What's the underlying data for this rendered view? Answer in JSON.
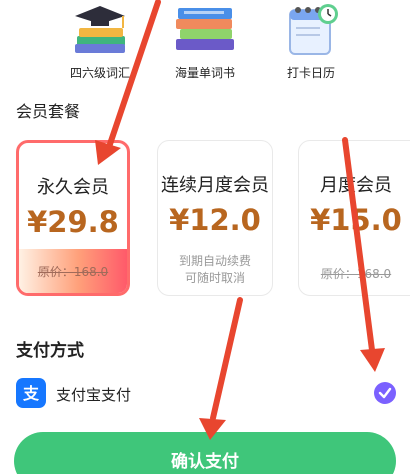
{
  "features": [
    {
      "label": "四六级词汇",
      "icon": "grad-cap-books-icon"
    },
    {
      "label": "海量单词书",
      "icon": "book-stack-icon"
    },
    {
      "label": "打卡日历",
      "icon": "calendar-clock-icon"
    }
  ],
  "membership": {
    "title": "会员套餐",
    "plans": [
      {
        "name": "永久会员",
        "price": "¥29.8",
        "original": "原价：168.0",
        "selected": true
      },
      {
        "name": "连续月度会员",
        "price": "¥12.0",
        "note_line1": "到期自动续费",
        "note_line2": "可随时取消",
        "selected": false
      },
      {
        "name": "月度会员",
        "price": "¥15.0",
        "original": "原价：168.0",
        "selected": false
      }
    ]
  },
  "payment": {
    "title": "支付方式",
    "method": "支付宝支付",
    "method_icon": "alipay-icon",
    "icon_glyph": "支"
  },
  "confirm_button": "确认支付",
  "colors": {
    "accent_price": "#b8661f",
    "selected_border": "#ff6b6b",
    "confirm": "#3fc67a",
    "check": "#7b61ff",
    "arrow": "#e8462f"
  }
}
